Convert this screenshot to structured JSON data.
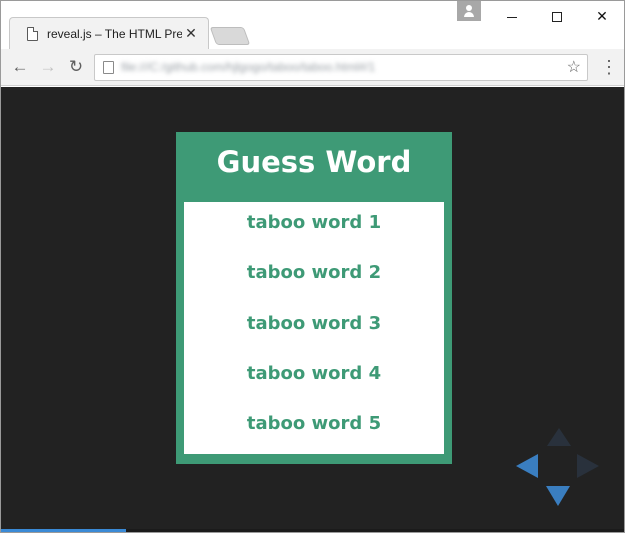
{
  "browser": {
    "tab_title": "reveal.js – The HTML Pres",
    "tab_close_glyph": "✕",
    "url": "file:///C:/github.com/hjlgogo/taboo/taboo.html#/1",
    "window_close_glyph": "✕",
    "back_glyph": "←",
    "forward_glyph": "→",
    "reload_glyph": "↻",
    "star_glyph": "☆",
    "menu_glyph": "⋮"
  },
  "slide": {
    "title": "Guess Word",
    "taboo_words": [
      "taboo word 1",
      "taboo word 2",
      "taboo word 3",
      "taboo word 4",
      "taboo word 5"
    ]
  },
  "progress": {
    "fraction": 0.2
  },
  "colors": {
    "card": "#3e9a76",
    "background": "#222222",
    "control_active": "#3a7ec0",
    "control_inactive": "#29313c"
  },
  "icons": {
    "page": "page-icon",
    "profile": "profile-icon",
    "star": "star-icon",
    "menu": "menu-icon"
  }
}
